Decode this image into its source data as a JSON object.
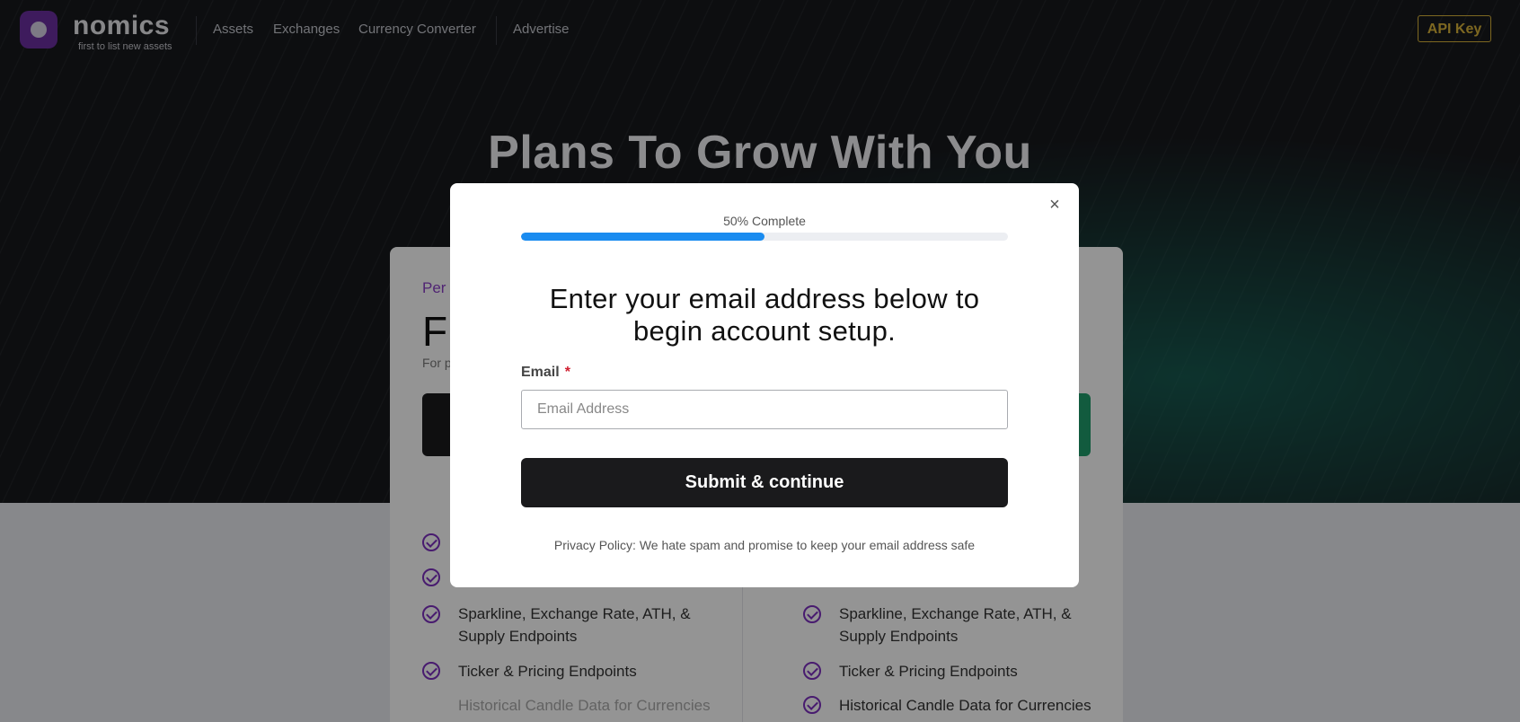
{
  "nav": {
    "logo_text": "nomics",
    "logo_tagline": "first to list new assets",
    "links": [
      "Assets",
      "Exchanges",
      "Currency Converter",
      "Advertise"
    ],
    "api_key_label": "API Key"
  },
  "hero": {
    "title": "Plans To Grow With You"
  },
  "plans": {
    "left": {
      "tag": "Per",
      "name": "Fr",
      "desc": "For p"
    }
  },
  "features_left": [
    "",
    "",
    "Sparkline, Exchange Rate, ATH, &",
    "Supply Endpoints",
    "Ticker & Pricing Endpoints",
    "Historical Candle Data for Currencies"
  ],
  "features_right": [
    "Sparkline, Exchange Rate, ATH, &",
    "Supply Endpoints",
    "Ticker & Pricing Endpoints",
    "Historical Candle Data for Currencies"
  ],
  "modal": {
    "progress_label": "50% Complete",
    "progress_value": 0.5,
    "heading": "Enter your email address below to begin account setup.",
    "email_label": "Email",
    "required_mark": "*",
    "email_placeholder": "Email Address",
    "email_value": "",
    "submit_label": "Submit & continue",
    "privacy_text": "Privacy Policy: We hate spam and promise to keep your email address safe",
    "close_icon": "×"
  },
  "colors": {
    "accent_blue": "#1a8cf0",
    "api_gold": "#d9b43a",
    "purple": "#7d2fc0",
    "submit_bg": "#1a1a1c"
  }
}
